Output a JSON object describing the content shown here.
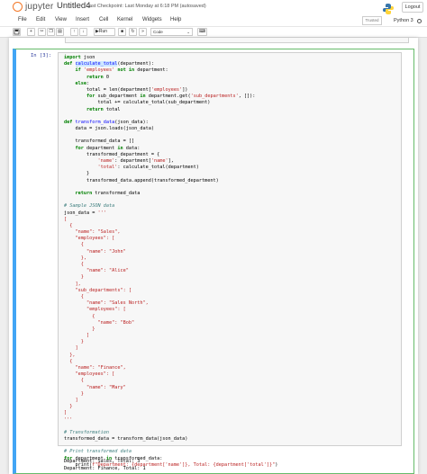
{
  "header": {
    "logo_text": "jupyter",
    "notebook_title": "Untitled4",
    "checkpoint": "Last Checkpoint: Last Monday at 6:18 PM  (autosaved)",
    "logout_label": "Logout"
  },
  "menu": {
    "items": [
      "File",
      "Edit",
      "View",
      "Insert",
      "Cell",
      "Kernel",
      "Widgets",
      "Help"
    ],
    "trusted": "Trusted",
    "kernel": "Python 3"
  },
  "toolbar": {
    "run_label": "Run",
    "cell_type": "Code"
  },
  "cell": {
    "prompt": "In [3]:",
    "output_lines": [
      "Department: Sales, Total: 3",
      "Department: Finance, Total: 1"
    ]
  },
  "colors": {
    "brand": "#f37726",
    "prompt": "#303f9f",
    "cell_border_selected": "#42a5f5",
    "keyword": "#008000",
    "string": "#ba2121",
    "comment": "#408080"
  }
}
